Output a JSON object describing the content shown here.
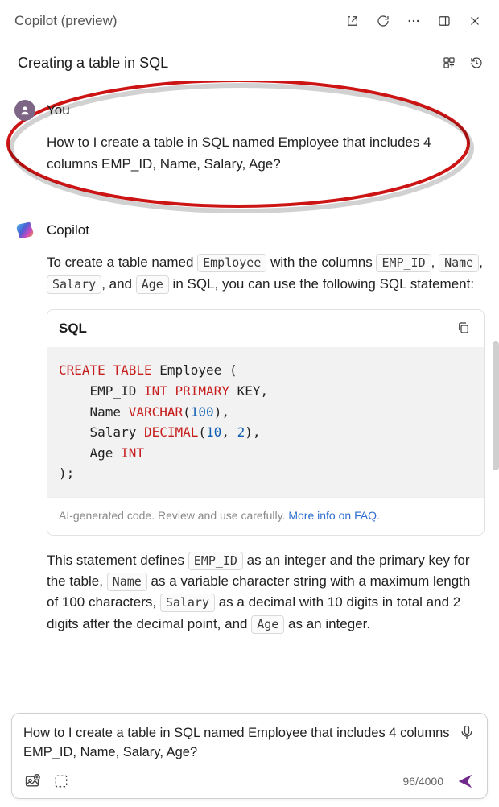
{
  "header": {
    "title": "Copilot (preview)"
  },
  "subheader": {
    "title": "Creating a table in SQL"
  },
  "messages": {
    "user": {
      "sender": "You",
      "text": "How to I create a table in SQL named Employee that includes 4 columns EMP_ID, Name, Salary, Age?"
    },
    "assistant": {
      "sender": "Copilot",
      "intro_pre": "To create a table named ",
      "intro_employee": "Employee",
      "intro_mid": " with the columns ",
      "c1": "EMP_ID",
      "sep1": ", ",
      "c2": "Name",
      "sep2": ", ",
      "c3": "Salary",
      "sep3": ", and ",
      "c4": "Age",
      "intro_post": " in SQL, you can use the following SQL statement:",
      "code_lang": "SQL",
      "code": {
        "l1a": "CREATE",
        "l1b": "TABLE",
        "l1c": " Employee (",
        "l2a": "    EMP_ID ",
        "l2b": "INT",
        "l2c": "PRIMARY",
        "l2d": " KEY,",
        "l3a": "    Name ",
        "l3b": "VARCHAR",
        "l3c": "(",
        "l3d": "100",
        "l3e": "),",
        "l4a": "    Salary ",
        "l4b": "DECIMAL",
        "l4c": "(",
        "l4d": "10",
        "l4e": ", ",
        "l4f": "2",
        "l4g": "),",
        "l5a": "    Age ",
        "l5b": "INT",
        "l6": ");"
      },
      "code_footer_text": "AI-generated code. Review and use carefully. ",
      "code_footer_link": "More info on FAQ",
      "expl_pre": "This statement defines ",
      "e1": "EMP_ID",
      "expl_m1": " as an integer and the primary key for the table, ",
      "e2": "Name",
      "expl_m2": " as a variable character string with a maximum length of 100 characters, ",
      "e3": "Salary",
      "expl_m3": " as a decimal with 10 digits in total and 2 digits after the decimal point, and ",
      "e4": "Age",
      "expl_post": " as an integer."
    }
  },
  "input": {
    "value": "How to I create a table in SQL named Employee that includes 4 columns EMP_ID, Name, Salary, Age?",
    "counter": "96/4000"
  }
}
